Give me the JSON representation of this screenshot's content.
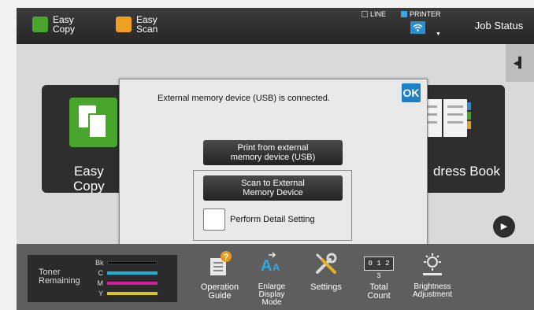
{
  "topbar": {
    "easy_copy": "Easy\nCopy",
    "easy_scan": "Easy\nScan",
    "line_label": "LINE",
    "printer_label": "PRINTER",
    "job_status": "Job Status"
  },
  "main": {
    "side_tab_icon": "◂▍",
    "tile_copy_label": "Easy\nCopy",
    "tile_address_label": "dress Book",
    "next_icon": "▶"
  },
  "popup": {
    "message": "External memory device (USB) is connected.",
    "ok": "OK",
    "print_usb": "Print from external\nmemory device (USB)",
    "scan_usb": "Scan to External\nMemory Device",
    "detail_setting": "Perform Detail Setting"
  },
  "bottom": {
    "toner_title": "Toner\nRemaining",
    "toner": [
      {
        "key": "Bk",
        "color": "#000000"
      },
      {
        "key": "C",
        "color": "#1ab0d8"
      },
      {
        "key": "M",
        "color": "#d21c9c"
      },
      {
        "key": "Y",
        "color": "#d8c81c"
      }
    ],
    "operation_guide": "Operation\nGuide",
    "enlarge_display": "Enlarge\nDisplay\nMode",
    "settings": "Settings",
    "total_count": "Total\nCount",
    "brightness": "Brightness\nAdjustment",
    "counter_digits": "0 1 2 3"
  },
  "colors": {
    "accent_blue": "#1d7fc4",
    "copy_green": "#4aa52e",
    "scan_orange": "#f0a020"
  }
}
